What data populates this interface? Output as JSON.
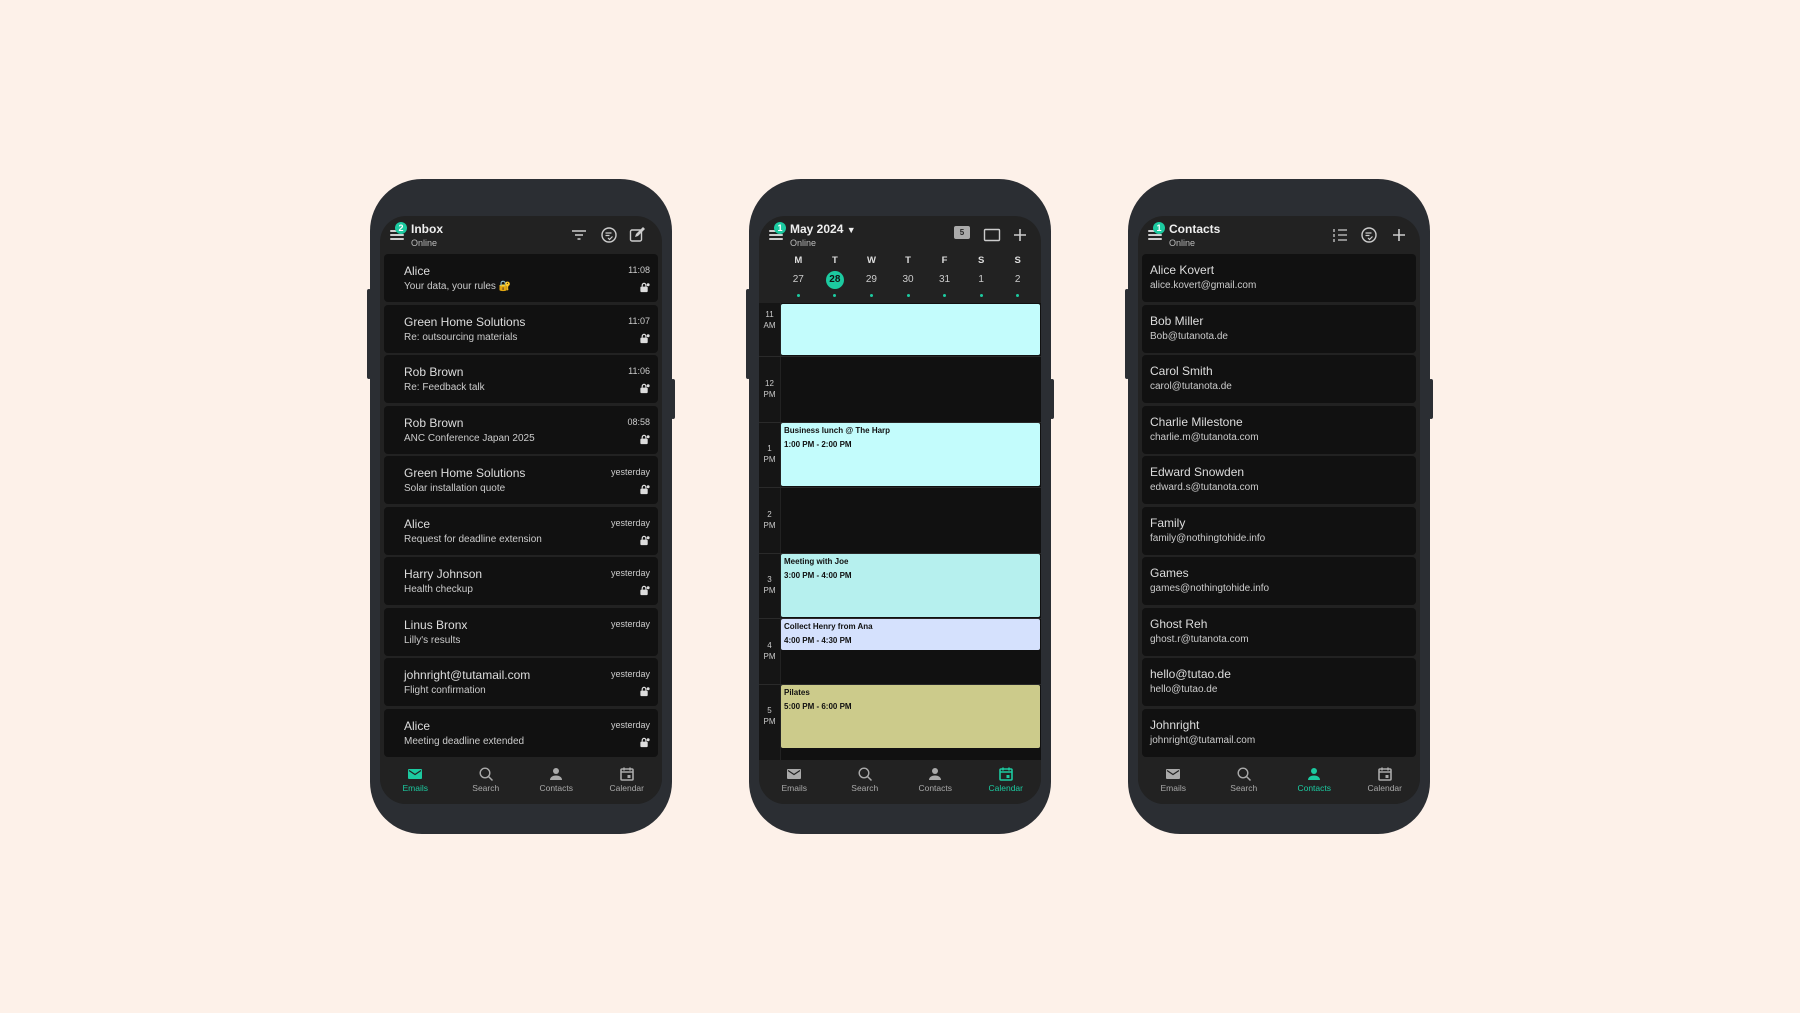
{
  "colors": {
    "accent": "#1ccaa0",
    "background": "#fdf1e9"
  },
  "nav": [
    "Emails",
    "Search",
    "Contacts",
    "Calendar"
  ],
  "mail": {
    "title": "Inbox",
    "badge": "2",
    "status": "Online",
    "icons": [
      "filter-icon",
      "select-icon",
      "compose-icon"
    ],
    "items": [
      {
        "sender": "Alice",
        "subject": "Your data, your rules 🔐",
        "time": "11:08",
        "encrypted": true
      },
      {
        "sender": "Green Home Solutions",
        "subject": "Re: outsourcing materials",
        "time": "11:07",
        "encrypted": true
      },
      {
        "sender": "Rob Brown",
        "subject": "Re: Feedback talk",
        "time": "11:06",
        "encrypted": true
      },
      {
        "sender": "Rob Brown",
        "subject": "ANC Conference Japan 2025",
        "time": "08:58",
        "encrypted": true
      },
      {
        "sender": "Green Home Solutions",
        "subject": "Solar installation quote",
        "time": "yesterday",
        "encrypted": true
      },
      {
        "sender": "Alice",
        "subject": "Request for deadline extension",
        "time": "yesterday",
        "encrypted": true
      },
      {
        "sender": "Harry Johnson",
        "subject": "Health checkup",
        "time": "yesterday",
        "encrypted": true
      },
      {
        "sender": "Linus Bronx",
        "subject": "Lilly's results",
        "time": "yesterday",
        "encrypted": false
      },
      {
        "sender": "johnright@tutamail.com",
        "subject": "Flight confirmation",
        "time": "yesterday",
        "encrypted": true
      },
      {
        "sender": "Alice",
        "subject": "Meeting deadline extended",
        "time": "yesterday",
        "encrypted": true
      }
    ],
    "active_nav": 0
  },
  "calendar": {
    "title": "May 2024",
    "badge": "1",
    "status": "Online",
    "day_view_number": "5",
    "weekdays": [
      "M",
      "T",
      "W",
      "T",
      "F",
      "S",
      "S"
    ],
    "dates": [
      "27",
      "28",
      "29",
      "30",
      "31",
      "1",
      "2"
    ],
    "today_index": 1,
    "hours": [
      [
        "11",
        "AM"
      ],
      [
        "12",
        "PM"
      ],
      [
        "1",
        "PM"
      ],
      [
        "2",
        "PM"
      ],
      [
        "3",
        "PM"
      ],
      [
        "4",
        "PM"
      ],
      [
        "5",
        "PM"
      ]
    ],
    "events": [
      {
        "title": "",
        "time": "",
        "start": 11,
        "end": 12,
        "color": "#c3fcfc"
      },
      {
        "title": "Business lunch @ The Harp",
        "time": "1:00 PM - 2:00 PM",
        "start": 13,
        "end": 14,
        "color": "#c3fcfc"
      },
      {
        "title": "Meeting with Joe",
        "time": "3:00 PM - 4:00 PM",
        "start": 15,
        "end": 16,
        "color": "#b6f0ee"
      },
      {
        "title": "Collect Henry from Ana",
        "time": "4:00 PM - 4:30 PM",
        "start": 16,
        "end": 16.5,
        "color": "#d5e1fd"
      },
      {
        "title": "Pilates",
        "time": "5:00 PM - 6:00 PM",
        "start": 17,
        "end": 18,
        "color": "#cccb8b"
      }
    ],
    "active_nav": 3
  },
  "contacts": {
    "title": "Contacts",
    "badge": "1",
    "status": "Online",
    "items": [
      {
        "name": "Alice Kovert",
        "email": "alice.kovert@gmail.com"
      },
      {
        "name": "Bob Miller",
        "email": "Bob@tutanota.de"
      },
      {
        "name": "Carol Smith",
        "email": "carol@tutanota.de"
      },
      {
        "name": "Charlie Milestone",
        "email": "charlie.m@tutanota.com"
      },
      {
        "name": "Edward Snowden",
        "email": "edward.s@tutanota.com"
      },
      {
        "name": "Family",
        "email": "family@nothingtohide.info"
      },
      {
        "name": "Games",
        "email": "games@nothingtohide.info"
      },
      {
        "name": "Ghost Reh",
        "email": "ghost.r@tutanota.com"
      },
      {
        "name": "hello@tutao.de",
        "email": "hello@tutao.de"
      },
      {
        "name": "Johnright",
        "email": "johnright@tutamail.com"
      }
    ],
    "active_nav": 2
  }
}
